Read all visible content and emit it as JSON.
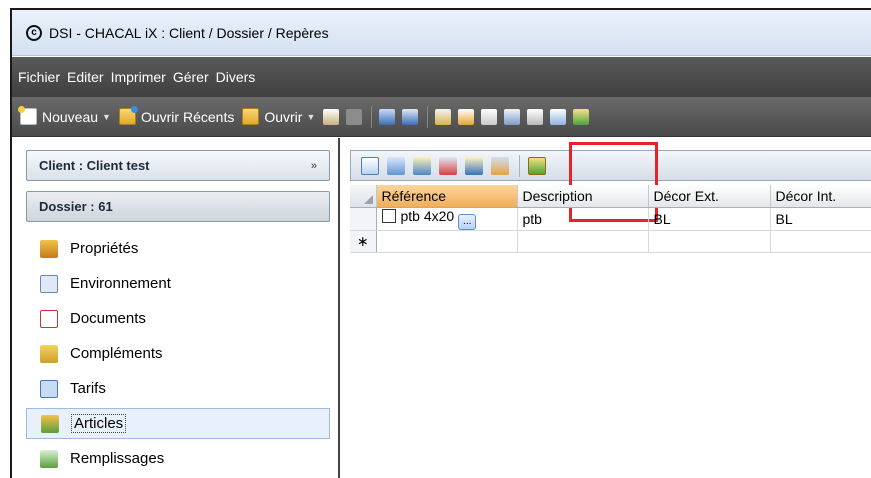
{
  "window": {
    "title": "DSI - CHACAL iX : Client / Dossier / Repères",
    "app_icon_glyph": "c"
  },
  "menu": [
    "Fichier",
    "Editer",
    "Imprimer",
    "Gérer",
    "Divers"
  ],
  "toolbar": {
    "new_label": "Nouveau",
    "recent_label": "Ouvrir Récents",
    "open_label": "Ouvrir"
  },
  "left_panel": {
    "client_label": "Client : Client test",
    "client_chevron": "»",
    "dossier_label": "Dossier : 61",
    "nav_items": [
      {
        "label": "Propriétés",
        "icon": "properties-icon"
      },
      {
        "label": "Environnement",
        "icon": "environment-icon"
      },
      {
        "label": "Documents",
        "icon": "pdf-icon"
      },
      {
        "label": "Compléments",
        "icon": "complements-icon"
      },
      {
        "label": "Tarifs",
        "icon": "tarifs-icon"
      },
      {
        "label": "Articles",
        "icon": "articles-icon",
        "selected": true
      },
      {
        "label": "Remplissages",
        "icon": "remplissages-icon"
      }
    ]
  },
  "grid": {
    "columns": [
      "Référence",
      "Description",
      "Décor Ext.",
      "Décor Int."
    ],
    "rows": [
      {
        "reference": "ptb 4x20",
        "description": "ptb",
        "decor_ext": "BL",
        "decor_int": "BL"
      }
    ],
    "new_row_marker": "∗",
    "ellipsis": "..."
  },
  "colors": {
    "highlight": "#e8222a",
    "selected_header": "#f2ae57",
    "menubar": "#4a4a4a"
  }
}
